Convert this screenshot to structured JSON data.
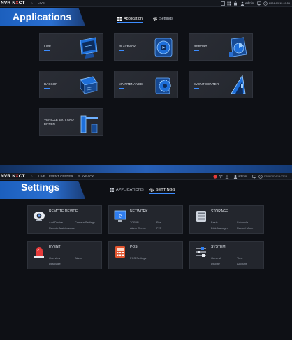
{
  "apps_screen": {
    "logo": {
      "part1": "NVR N",
      "part2": "X",
      "part3": "CT"
    },
    "nav": {
      "home": "⌂",
      "live": "LIVE"
    },
    "status": {
      "user": "admin",
      "datetime": "2024-09-13 09:55"
    },
    "banner_title": "Applications",
    "tabs": [
      {
        "label": "Application",
        "icon": "grid-icon"
      },
      {
        "label": "Settings",
        "icon": "gear-icon"
      }
    ],
    "tiles": [
      {
        "label": "LIVE",
        "icon": "monitor-icon"
      },
      {
        "label": "PLAYBACK",
        "icon": "playback-icon"
      },
      {
        "label": "REPORT",
        "icon": "report-icon"
      },
      {
        "label": "BACKUP",
        "icon": "backup-icon"
      },
      {
        "label": "MAINTENANCE",
        "icon": "maintenance-icon"
      },
      {
        "label": "EVENT CENTER",
        "icon": "event-center-icon"
      },
      {
        "label": "VEHICLE EXIT AND ENTER",
        "icon": "vehicle-barrier-icon"
      }
    ]
  },
  "settings_screen": {
    "logo": {
      "part1": "NVR N",
      "part2": "X",
      "part3": "CT"
    },
    "nav": {
      "home": "⌂",
      "live": "LIVE",
      "event_center": "EVENT CENTER",
      "playback": "PLAYBACK"
    },
    "status": {
      "user": "admin",
      "datetime": "02/09/2024 19:32:15"
    },
    "banner_title": "Settings",
    "tabs": [
      {
        "label": "APPLICATIONS",
        "icon": "grid-icon"
      },
      {
        "label": "SETTINGS",
        "icon": "gear-icon"
      }
    ],
    "cards": [
      {
        "title": "REMOTE DEVICE",
        "icon": "camera-icon",
        "items": [
          "Add Device",
          "Camera Settings",
          "Remote Maintenance"
        ]
      },
      {
        "title": "NETWORK",
        "icon": "network-icon",
        "items": [
          "TCP/IP",
          "Port",
          "Alarm Center",
          "P2P"
        ]
      },
      {
        "title": "STORAGE",
        "icon": "storage-icon",
        "items": [
          "Basic",
          "Schedule",
          "Disk Manager",
          "Record Mode"
        ]
      },
      {
        "title": "EVENT",
        "icon": "alarm-light-icon",
        "items": [
          "Overview",
          "Alarm",
          "Database"
        ]
      },
      {
        "title": "POS",
        "icon": "pos-icon",
        "items": [
          "POS Settings"
        ]
      },
      {
        "title": "SYSTEM",
        "icon": "system-sliders-icon",
        "items": [
          "General",
          "Time",
          "Display",
          "Account"
        ]
      }
    ]
  },
  "colors": {
    "accent": "#3c8cff",
    "banner": "#2a6fd0",
    "tile_bg": "#2a2d35",
    "page_bg": "#0e1015",
    "alert": "#e63b3b"
  }
}
